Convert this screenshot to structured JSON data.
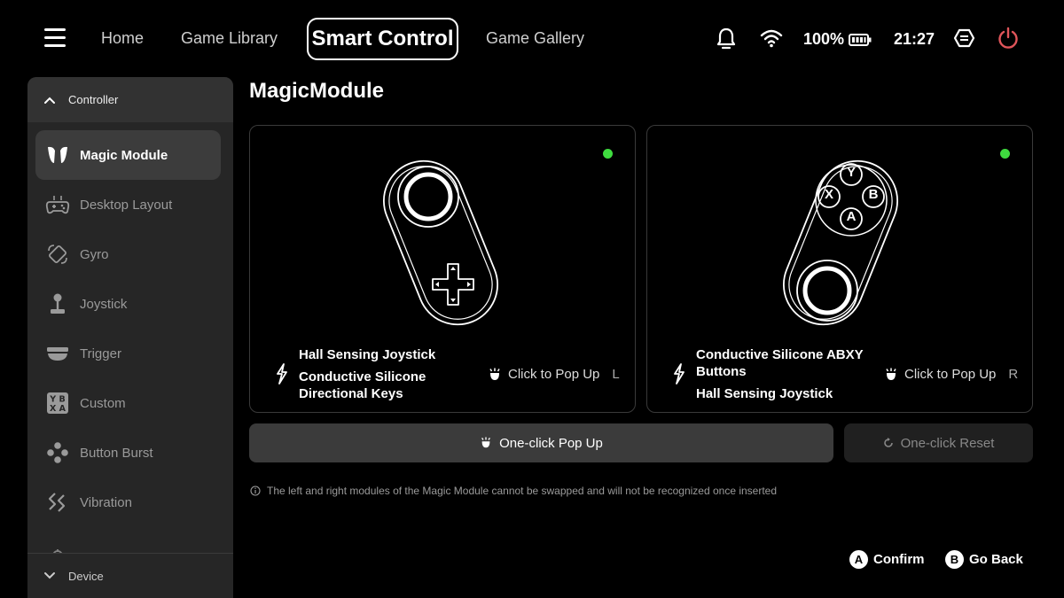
{
  "nav": {
    "items": [
      "Home",
      "Game Library",
      "Smart Control",
      "Game Gallery"
    ],
    "active": "Smart Control"
  },
  "status": {
    "battery": "100%",
    "time": "21:27",
    "icons": [
      "bell-icon",
      "wifi-icon",
      "battery-icon",
      "hexagon-settings-icon",
      "power-icon"
    ]
  },
  "sidebar": {
    "header": "Controller",
    "items": [
      {
        "label": "Magic Module",
        "icon": "magic-module-icon",
        "active": true
      },
      {
        "label": "Desktop Layout",
        "icon": "gamepad-icon"
      },
      {
        "label": "Gyro",
        "icon": "gyro-icon"
      },
      {
        "label": "Joystick",
        "icon": "joystick-icon"
      },
      {
        "label": "Trigger",
        "icon": "trigger-icon"
      },
      {
        "label": "Custom",
        "icon": "custom-icon"
      },
      {
        "label": "Button Burst",
        "icon": "button-burst-icon"
      },
      {
        "label": "Vibration",
        "icon": "vibration-icon"
      }
    ],
    "footer": "Device"
  },
  "main": {
    "title": "MagicModule",
    "left_card": {
      "features": [
        "Hall Sensing Joystick",
        "Conductive Silicone Directional Keys"
      ],
      "popup_label": "Click to Pop Up",
      "side": "L",
      "status_color": "#3fdc3f"
    },
    "right_card": {
      "features": [
        "Conductive Silicone ABXY Buttons",
        "Hall Sensing Joystick"
      ],
      "popup_label": "Click to Pop Up",
      "side": "R",
      "buttons": [
        "Y",
        "X",
        "B",
        "A"
      ],
      "status_color": "#3fdc3f"
    },
    "popup_button": "One-click Pop Up",
    "reset_button": "One-click Reset",
    "note": "The left and right modules of the Magic Module cannot be swapped and will not be recognized once inserted"
  },
  "hints": [
    {
      "key": "A",
      "label": "Confirm"
    },
    {
      "key": "B",
      "label": "Go Back"
    }
  ]
}
